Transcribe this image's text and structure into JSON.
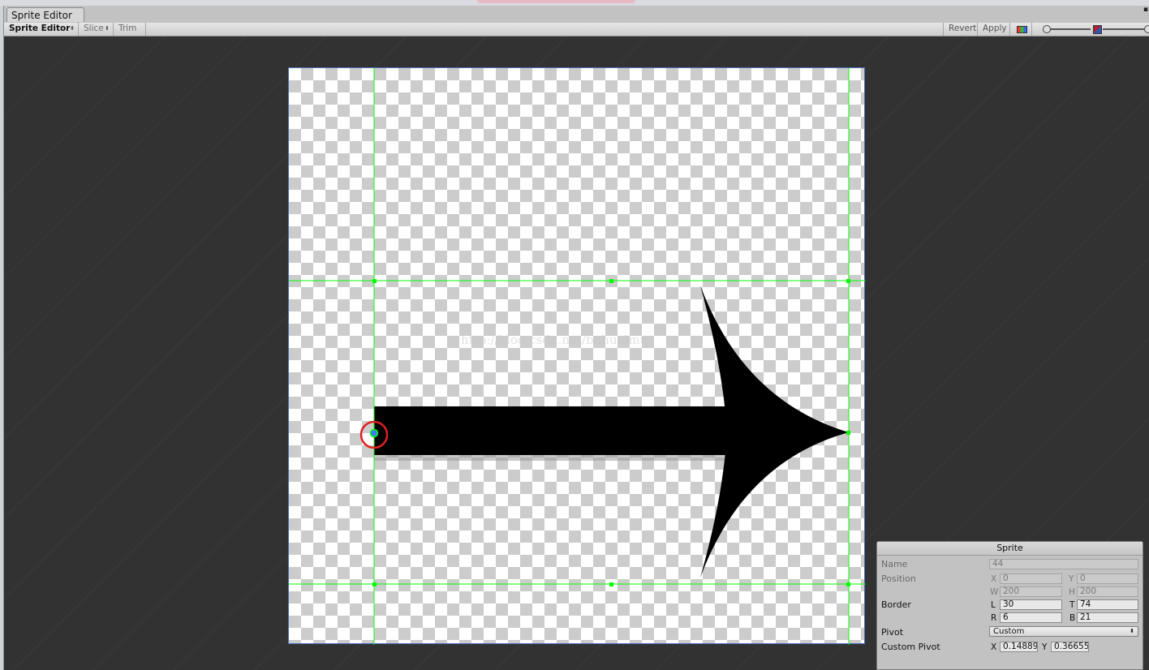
{
  "window": {
    "tab_title": "Sprite Editor",
    "menu_glyph": "▪"
  },
  "toolbar": {
    "mode_label": "Sprite Editor",
    "slice_label": "Slice",
    "trim_label": "Trim",
    "revert_label": "Revert",
    "apply_label": "Apply",
    "dropdown_glyph": "⬍"
  },
  "canvas": {
    "watermark": "http://blog.csdn.net/buhuolmu"
  },
  "inspector": {
    "title": "Sprite",
    "name_label": "Name",
    "name_value": "44",
    "position_label": "Position",
    "x_label": "X",
    "x_value": "0",
    "y_label": "Y",
    "y_value": "0",
    "w_label": "W",
    "w_value": "200",
    "h_label": "H",
    "h_value": "200",
    "border_label": "Border",
    "l_label": "L",
    "l_value": "30",
    "t_label": "T",
    "t_value": "74",
    "r_label": "R",
    "r_value": "6",
    "b_label": "B",
    "b_value": "21",
    "pivot_label": "Pivot",
    "pivot_value": "Custom",
    "custom_pivot_label": "Custom Pivot",
    "cx_label": "X",
    "cx_value": "0.14889",
    "cy_label": "Y",
    "cy_value": "0.36655"
  },
  "colors": {
    "border_guides": "#00ff00",
    "pivot_highlight": "#e02020",
    "sprite_outline": "#4b72b8",
    "background": "#323232"
  }
}
